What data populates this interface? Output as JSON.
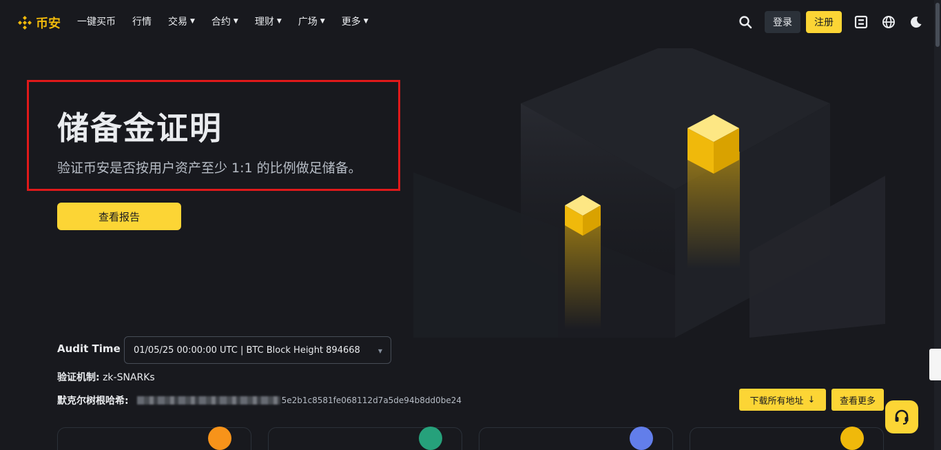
{
  "nav": {
    "brand": "币安",
    "items": [
      {
        "label": "一键买币",
        "dropdown": false
      },
      {
        "label": "行情",
        "dropdown": false
      },
      {
        "label": "交易",
        "dropdown": true
      },
      {
        "label": "合约",
        "dropdown": true
      },
      {
        "label": "理财",
        "dropdown": true
      },
      {
        "label": "广场",
        "dropdown": true
      },
      {
        "label": "更多",
        "dropdown": true
      }
    ],
    "login_label": "登录",
    "register_label": "注册"
  },
  "hero": {
    "title": "储备金证明",
    "subtitle": "验证币安是否按用户资产至少 1:1 的比例做足储备。",
    "report_button": "查看报告"
  },
  "audit": {
    "label": "Audit Time",
    "selected": "01/05/25 00:00:00 UTC | BTC Block Height 894668",
    "mechanism_label": "验证机制:",
    "mechanism_value": "zk-SNARKs",
    "merkle_label": "默克尔树根哈希:",
    "merkle_hash_visible_tail": "5e2b1c8581fe068112d7a5de94b8dd0be24",
    "download_label": "下载所有地址",
    "more_label": "查看更多"
  },
  "colors": {
    "accent": "#fcd535",
    "brand": "#f0b90b",
    "background": "#18191e",
    "highlight": "#e0191a"
  },
  "cards": [
    {
      "coin_color": "#f7931a"
    },
    {
      "coin_color": "#26a17b"
    },
    {
      "coin_color": "#627eea"
    },
    {
      "coin_color": "#f0b90b"
    }
  ]
}
